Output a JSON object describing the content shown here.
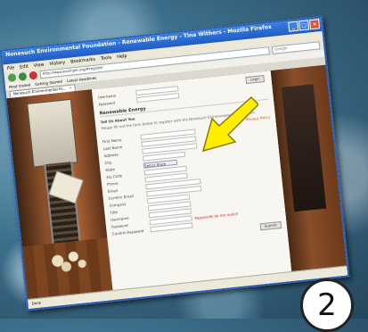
{
  "window": {
    "title": "Nonesuch Environmental Foundation - Renewable Energy - Tina Withers - Mozilla Firefox",
    "menu": [
      "File",
      "Edit",
      "View",
      "History",
      "Bookmarks",
      "Tools",
      "Help"
    ],
    "url": "http://www.example.org/#register",
    "search_placeholder": "Google",
    "bookmarks": [
      "Most Visited",
      "Getting Started",
      "Latest Headlines"
    ],
    "tabs": [
      {
        "label": "Nonesuch Environmental Fo...",
        "active": true
      }
    ],
    "status": "Done"
  },
  "page": {
    "top_fields": [
      {
        "label": "Username"
      },
      {
        "label": "Password"
      }
    ],
    "login_button": "Login",
    "section_title": "Renewable Energy",
    "intro_title": "Tell Us About You",
    "intro_text": "Please fill out the form below to register with the Nonesuch Environmental Foundation.",
    "privacy_link": "Privacy Policy",
    "form_fields": [
      {
        "label": "First Name"
      },
      {
        "label": "Last Name"
      },
      {
        "label": "Address"
      },
      {
        "label": "City"
      },
      {
        "label": "State"
      },
      {
        "label": "Zip Code"
      },
      {
        "label": "Phone"
      },
      {
        "label": "Email"
      },
      {
        "label": "Confirm Email"
      },
      {
        "label": "Company"
      },
      {
        "label": "Title"
      },
      {
        "label": "Username"
      },
      {
        "label": "Password"
      },
      {
        "label": "Confirm Password"
      }
    ],
    "state_select": "Select State",
    "error_text": "Passwords do not match",
    "submit_button": "Submit"
  },
  "annotation": {
    "step_number": "2",
    "arrow_color": "#ffee00"
  }
}
